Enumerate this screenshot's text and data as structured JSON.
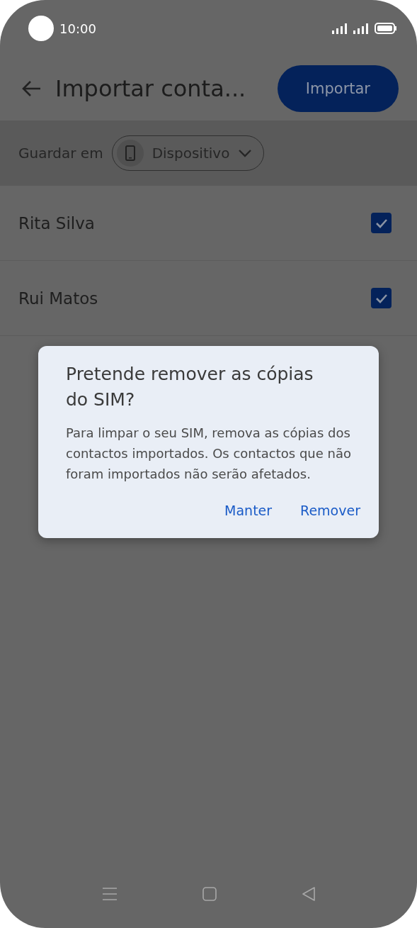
{
  "status_bar": {
    "time": "10:00"
  },
  "app_bar": {
    "title": "Importar conta...",
    "action": "Importar"
  },
  "save_to": {
    "label": "Guardar em",
    "value": "Dispositivo"
  },
  "contacts": [
    {
      "name": "Rita Silva",
      "checked": true
    },
    {
      "name": "Rui Matos",
      "checked": true
    }
  ],
  "dialog": {
    "title": "Pretende remover as cópias do SIM?",
    "message": "Para limpar o seu SIM, remova as cópias dos contactos importados. Os contactos que não foram importados não serão afetados.",
    "buttons": [
      "Manter",
      "Remover"
    ]
  }
}
